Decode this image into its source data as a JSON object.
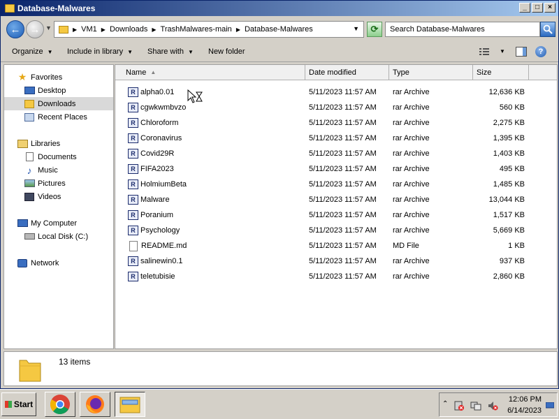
{
  "window": {
    "title": "Database-Malwares",
    "buttons": {
      "minimize": "_",
      "maximize": "□",
      "close": "×"
    }
  },
  "address": {
    "crumbs": [
      "VM1",
      "Downloads",
      "TrashMalwares-main",
      "Database-Malwares"
    ],
    "search_placeholder": "Search Database-Malwares"
  },
  "toolbar": {
    "organize": "Organize",
    "include_in_library": "Include in library",
    "share_with": "Share with",
    "new_folder": "New folder"
  },
  "navpane": {
    "favorites": "Favorites",
    "desktop": "Desktop",
    "downloads": "Downloads",
    "recent_places": "Recent Places",
    "libraries": "Libraries",
    "documents": "Documents",
    "music": "Music",
    "pictures": "Pictures",
    "videos": "Videos",
    "my_computer": "My Computer",
    "local_disk": "Local Disk (C:)",
    "network": "Network"
  },
  "columns": {
    "name": "Name",
    "date_modified": "Date modified",
    "type": "Type",
    "size": "Size"
  },
  "files": [
    {
      "name": "alpha0.01",
      "date": "5/11/2023 11:57 AM",
      "type": "rar Archive",
      "size": "12,636 KB",
      "icon": "rar-icon"
    },
    {
      "name": "cgwkwmbvzo",
      "date": "5/11/2023 11:57 AM",
      "type": "rar Archive",
      "size": "560 KB",
      "icon": "rar-icon"
    },
    {
      "name": "Chloroform",
      "date": "5/11/2023 11:57 AM",
      "type": "rar Archive",
      "size": "2,275 KB",
      "icon": "rar-icon"
    },
    {
      "name": "Coronavirus",
      "date": "5/11/2023 11:57 AM",
      "type": "rar Archive",
      "size": "1,395 KB",
      "icon": "rar-icon"
    },
    {
      "name": "Covid29R",
      "date": "5/11/2023 11:57 AM",
      "type": "rar Archive",
      "size": "1,403 KB",
      "icon": "rar-icon"
    },
    {
      "name": "FIFA2023",
      "date": "5/11/2023 11:57 AM",
      "type": "rar Archive",
      "size": "495 KB",
      "icon": "rar-icon"
    },
    {
      "name": "HolmiumBeta",
      "date": "5/11/2023 11:57 AM",
      "type": "rar Archive",
      "size": "1,485 KB",
      "icon": "rar-icon"
    },
    {
      "name": "Malware",
      "date": "5/11/2023 11:57 AM",
      "type": "rar Archive",
      "size": "13,044 KB",
      "icon": "rar-icon"
    },
    {
      "name": "Poranium",
      "date": "5/11/2023 11:57 AM",
      "type": "rar Archive",
      "size": "1,517 KB",
      "icon": "rar-icon"
    },
    {
      "name": "Psychology",
      "date": "5/11/2023 11:57 AM",
      "type": "rar Archive",
      "size": "5,669 KB",
      "icon": "rar-icon"
    },
    {
      "name": "README.md",
      "date": "5/11/2023 11:57 AM",
      "type": "MD File",
      "size": "1 KB",
      "icon": "document-icon"
    },
    {
      "name": "salinewin0.1",
      "date": "5/11/2023 11:57 AM",
      "type": "rar Archive",
      "size": "937 KB",
      "icon": "rar-icon"
    },
    {
      "name": "teletubisie",
      "date": "5/11/2023 11:57 AM",
      "type": "rar Archive",
      "size": "2,860 KB",
      "icon": "rar-icon"
    }
  ],
  "details": {
    "item_count": "13 items"
  },
  "taskbar": {
    "start": "Start",
    "time": "12:06 PM",
    "date": "6/14/2023"
  },
  "colors": {
    "title_gradient_start": "#0a246a",
    "title_gradient_end": "#a6caf0",
    "selected_nav": "#d9d9d9",
    "rar_icon": "#1c2c6c"
  }
}
